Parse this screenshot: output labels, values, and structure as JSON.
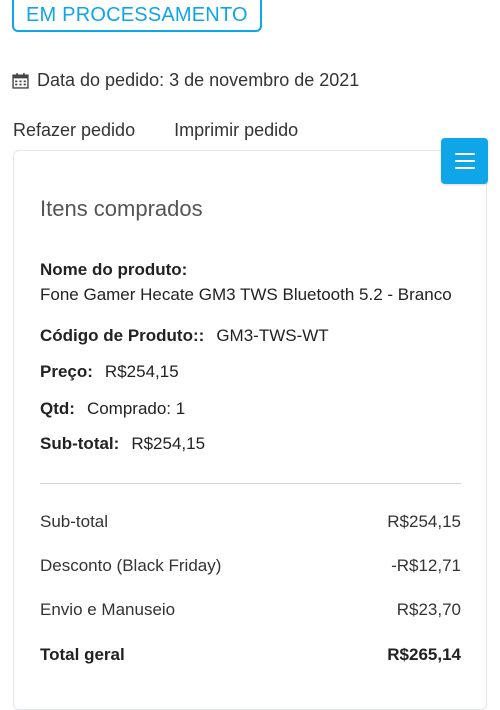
{
  "status": {
    "label": "EM PROCESSAMENTO",
    "color": "#0ea5e9"
  },
  "order": {
    "date_label": "Data do pedido:",
    "date_value": "3 de novembro de 2021"
  },
  "actions": {
    "reorder": "Refazer pedido",
    "print": "Imprimir pedido"
  },
  "menu": {
    "icon": "hamburger-menu-icon"
  },
  "items_section": {
    "title": "Itens comprados",
    "product_name_label": "Nome do produto:",
    "product_name_value": "Fone Gamer Hecate GM3 TWS Bluetooth 5.2 - Branco",
    "sku_label": "Código de Produto::",
    "sku_value": "GM3-TWS-WT",
    "price_label": "Preço:",
    "price_value": "R$254,15",
    "qty_label": "Qtd:",
    "qty_value": "Comprado: 1",
    "subtotal_label": "Sub-total:",
    "subtotal_value": "R$254,15"
  },
  "summary": {
    "rows": [
      {
        "label": "Sub-total",
        "value": "R$254,15"
      },
      {
        "label": "Desconto (Black Friday)",
        "value": "-R$12,71"
      },
      {
        "label": "Envio e Manuseio",
        "value": "R$23,70"
      }
    ],
    "total_label": "Total geral",
    "total_value": "R$265,14"
  }
}
